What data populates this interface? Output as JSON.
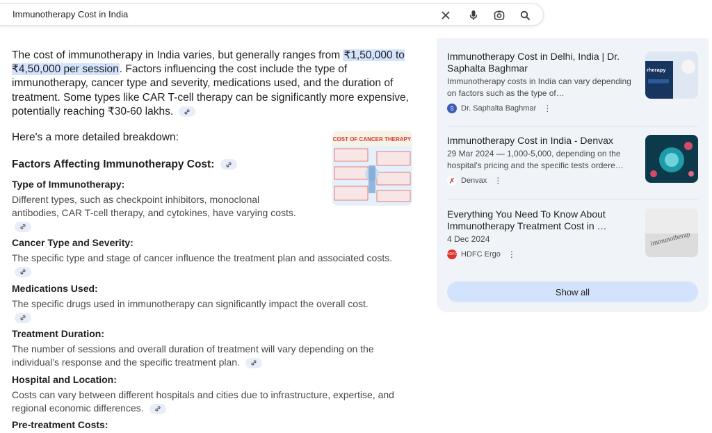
{
  "search": {
    "query": "Immunotherapy Cost in India"
  },
  "icons": {
    "clear": "close-icon",
    "voice": "microphone-icon",
    "lens": "lens-icon",
    "search": "search-icon",
    "link": "link-icon",
    "more": "more-vert-icon"
  },
  "overview": {
    "intro_pre": "The cost of immunotherapy in India varies, but generally ranges from",
    "intro_highlight": "₹1,50,000 to ₹4,50,000 per session",
    "intro_post": ". Factors influencing the cost include the type of immunotherapy, cancer type and severity, medications used, and the duration of treatment. Some types like CAR T-cell therapy can be significantly more expensive, potentially reaching ₹30-60 lakhs.",
    "breakdown": "Here's a more detailed breakdown:",
    "factors_title": "Factors Affecting Immunotherapy Cost:",
    "image_title": "COST OF CANCER THERAPY",
    "sections": [
      {
        "heading": "Type of Immunotherapy:",
        "body": "Different types, such as checkpoint inhibitors, monoclonal antibodies, CAR T-cell therapy, and cytokines, have varying costs."
      },
      {
        "heading": "Cancer Type and Severity:",
        "body": "The specific type and stage of cancer influence the treatment plan and associated costs."
      },
      {
        "heading": "Medications Used:",
        "body": "The specific drugs used in immunotherapy can significantly impact the overall cost."
      },
      {
        "heading": "Treatment Duration:",
        "body": "The number of sessions and overall duration of treatment will vary depending on the individual's response and the specific treatment plan."
      },
      {
        "heading": "Hospital and Location:",
        "body": "Costs can vary between different hospitals and cities due to infrastructure, expertise, and regional economic differences."
      },
      {
        "heading": "Pre-treatment Costs:",
        "body": ""
      }
    ]
  },
  "sources": {
    "cards": [
      {
        "title": "Immunotherapy Cost in Delhi, India | Dr. Saphalta Baghmar",
        "snippet": "Immunotherapy costs in India can vary depending on factors such as the type of…",
        "site": "Dr. Saphalta Baghmar",
        "site_initial": "S",
        "site_color": "#3b5bb5",
        "thumb_text": "rherapy"
      },
      {
        "title": "Immunotherapy Cost in India - Denvax",
        "snippet": "29 Mar 2024 — 1,000-5,000, depending on the hospital's pricing and the specific tests ordere…",
        "site": "Denvax",
        "site_initial": "✗",
        "site_color": "#ffffff"
      },
      {
        "title": "Everything You Need To Know About Immunotherapy Treatment Cost in …",
        "snippet": "4 Dec 2024",
        "site": "HDFC Ergo",
        "site_initial": "HDFC",
        "site_color": "#e0312b",
        "thumb_text": "immunotherap"
      }
    ],
    "show_all": "Show all"
  }
}
